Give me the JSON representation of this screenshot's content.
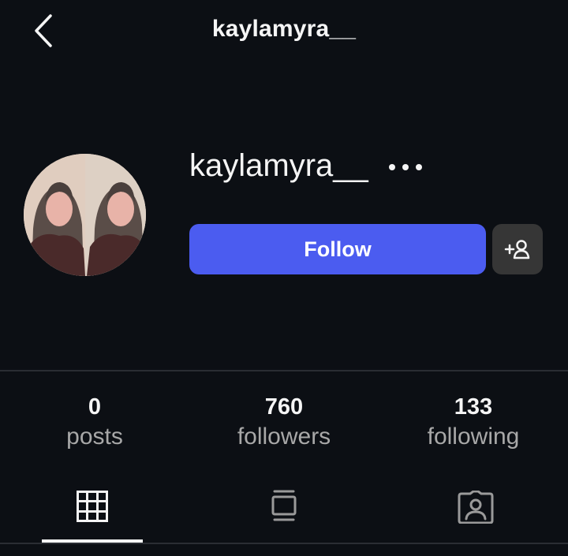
{
  "header": {
    "title": "kaylamyra__"
  },
  "profile": {
    "username": "kaylamyra__",
    "follow_label": "Follow"
  },
  "stats": [
    {
      "value": "0",
      "label": "posts"
    },
    {
      "value": "760",
      "label": "followers"
    },
    {
      "value": "133",
      "label": "following"
    }
  ],
  "icons": {
    "back": "chevron-left-icon",
    "more": "more-horizontal-icon",
    "add_friend": "add-user-icon",
    "grid": "grid-icon",
    "reels": "feed-icon",
    "tagged": "tagged-user-icon"
  },
  "colors": {
    "background": "#0c0f14",
    "accent": "#4b5cf0",
    "secondary_button": "#363636"
  }
}
